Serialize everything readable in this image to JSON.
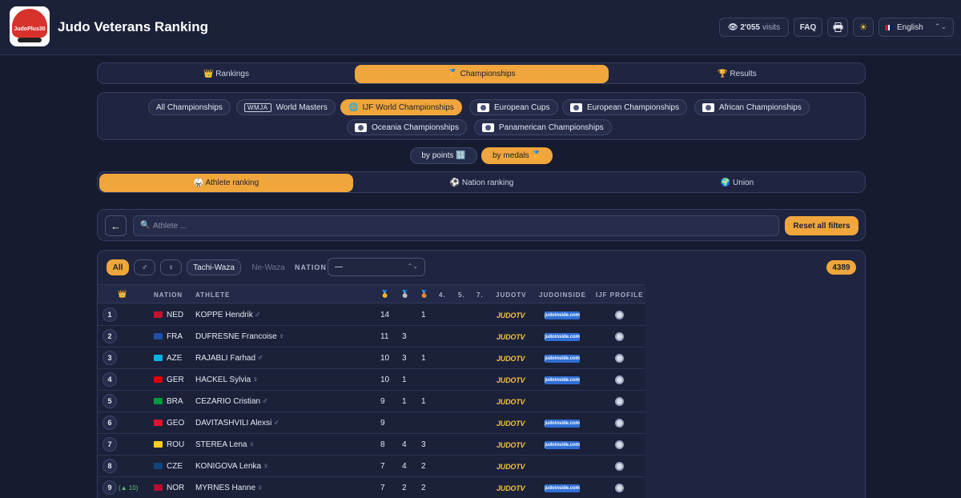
{
  "header": {
    "logo_text": "JudoPlus30",
    "title": "Judo Veterans Ranking",
    "visits_count": "2'055",
    "visits_label": "visits",
    "faq": "FAQ",
    "language": "English"
  },
  "main_tabs": [
    {
      "label": "👑 Rankings",
      "active": false
    },
    {
      "label": "🏅 Championships",
      "active": true
    },
    {
      "label": "🏆 Results",
      "active": false
    }
  ],
  "championships": [
    {
      "label": "All Championships",
      "badge": "",
      "active": false
    },
    {
      "label": "World Masters",
      "badge": "WMJA",
      "active": false
    },
    {
      "label": "IJF World Championships",
      "badge": "icon",
      "active": true
    },
    {
      "label": "European Cups",
      "badge": "icon",
      "active": false
    },
    {
      "label": "European Championships",
      "badge": "icon",
      "active": false
    },
    {
      "label": "African Championships",
      "badge": "icon",
      "active": false
    },
    {
      "label": "Oceania Championships",
      "badge": "icon",
      "active": false
    },
    {
      "label": "Panamerican Championships",
      "badge": "icon",
      "active": false
    }
  ],
  "sort": {
    "points": "by points 🔢",
    "medals": "by medals 🏅",
    "active": "medals"
  },
  "ranking_tabs": [
    {
      "label": "🥋 Athlete ranking",
      "active": true
    },
    {
      "label": "⚽ Nation ranking",
      "active": false
    },
    {
      "label": "🌍 Union",
      "active": false
    }
  ],
  "search": {
    "back": "←",
    "placeholder": "Athlete ...",
    "value": "",
    "reset": "Reset all filters"
  },
  "filters": {
    "all": "All",
    "male": "♂",
    "female": "♀",
    "tachi": "Tachi-Waza",
    "newaza": "Ne-Waza",
    "nation_label": "NATION",
    "nation_value": "—",
    "count": "4389"
  },
  "table": {
    "headers": {
      "rank": "👑",
      "nation": "NATION",
      "athlete": "ATHLETE",
      "gold": "🥇",
      "silver": "🥈",
      "bronze": "🥉",
      "p4": "4.",
      "p5": "5.",
      "p7": "7.",
      "judotv": "JUDOTV",
      "judoinside": "JUDOINSIDE",
      "ijf": "IJF PROFILE"
    },
    "judotv_label": "JUDOTV",
    "judoinside_label": "judoinside.com",
    "rows": [
      {
        "rank": "1",
        "trend": "",
        "nation": "NED",
        "flag": "#c8102e",
        "athlete": "KOPPE Hendrik",
        "gender": "♂",
        "gold": "14",
        "silver": "",
        "bronze": "1",
        "p4": "",
        "p5": "",
        "p7": "",
        "judoinside": true
      },
      {
        "rank": "2",
        "trend": "",
        "nation": "FRA",
        "flag": "#1f4fa8",
        "athlete": "DUFRESNE Francoise",
        "gender": "♀",
        "gold": "11",
        "silver": "3",
        "bronze": "",
        "p4": "",
        "p5": "",
        "p7": "",
        "judoinside": true
      },
      {
        "rank": "3",
        "trend": "",
        "nation": "AZE",
        "flag": "#00b5e2",
        "athlete": "RAJABLI Farhad",
        "gender": "♂",
        "gold": "10",
        "silver": "3",
        "bronze": "1",
        "p4": "",
        "p5": "",
        "p7": "",
        "judoinside": true
      },
      {
        "rank": "4",
        "trend": "",
        "nation": "GER",
        "flag": "#dd0000",
        "athlete": "HACKEL Sylvia",
        "gender": "♀",
        "gold": "10",
        "silver": "1",
        "bronze": "",
        "p4": "",
        "p5": "",
        "p7": "",
        "judoinside": true
      },
      {
        "rank": "5",
        "trend": "",
        "nation": "BRA",
        "flag": "#009b3a",
        "athlete": "CEZARIO Cristian",
        "gender": "♂",
        "gold": "9",
        "silver": "1",
        "bronze": "1",
        "p4": "",
        "p5": "",
        "p7": "",
        "judoinside": false
      },
      {
        "rank": "6",
        "trend": "",
        "nation": "GEO",
        "flag": "#e8112d",
        "athlete": "DAVITASHVILI Alexsi",
        "gender": "♂",
        "gold": "9",
        "silver": "",
        "bronze": "",
        "p4": "",
        "p5": "",
        "p7": "",
        "judoinside": true
      },
      {
        "rank": "7",
        "trend": "",
        "nation": "ROU",
        "flag": "#fcd116",
        "athlete": "STEREA Lena",
        "gender": "♀",
        "gold": "8",
        "silver": "4",
        "bronze": "3",
        "p4": "",
        "p5": "",
        "p7": "",
        "judoinside": true
      },
      {
        "rank": "8",
        "trend": "",
        "nation": "CZE",
        "flag": "#11457e",
        "athlete": "KONIGOVA Lenka",
        "gender": "♀",
        "gold": "7",
        "silver": "4",
        "bronze": "2",
        "p4": "",
        "p5": "",
        "p7": "",
        "judoinside": false
      },
      {
        "rank": "9",
        "trend": "(▲ 10)",
        "nation": "NOR",
        "flag": "#ba0c2f",
        "athlete": "MYRNES Hanne",
        "gender": "♀",
        "gold": "7",
        "silver": "2",
        "bronze": "2",
        "p4": "",
        "p5": "",
        "p7": "",
        "judoinside": true
      }
    ]
  }
}
